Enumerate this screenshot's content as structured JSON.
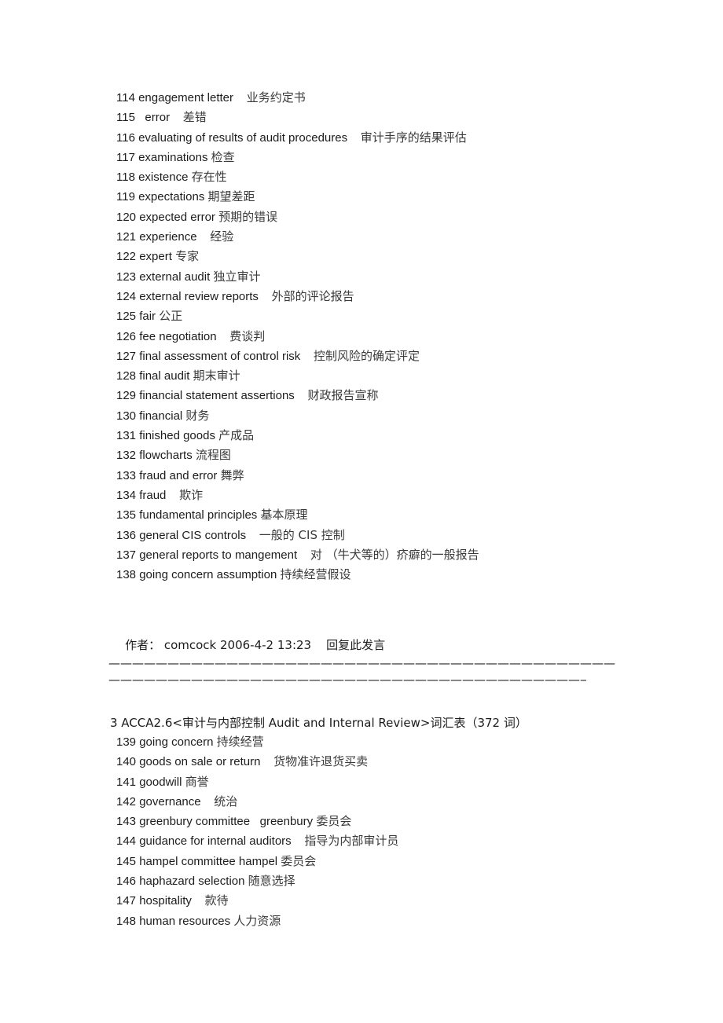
{
  "document": {
    "type": "forum-post-vocabulary-list",
    "background_color": "#ffffff",
    "text_color": "#1c1c1c",
    "secondary_text_color": "#3a3a3a"
  },
  "vocab_block_1": {
    "entries": [
      {
        "num": "114",
        "en": "engagement letter",
        "gap": "    ",
        "cn": "业务约定书"
      },
      {
        "num": "115",
        "en": "  error",
        "gap": "    ",
        "cn": "差错"
      },
      {
        "num": "116",
        "en": "evaluating of results of audit procedures",
        "gap": "    ",
        "cn": "审计手序的结果评估"
      },
      {
        "num": "117",
        "en": "examinations",
        "gap": " ",
        "cn": "检查"
      },
      {
        "num": "118",
        "en": "existence",
        "gap": " ",
        "cn": "存在性"
      },
      {
        "num": "119",
        "en": "expectations",
        "gap": " ",
        "cn": "期望差距"
      },
      {
        "num": "120",
        "en": "expected error",
        "gap": " ",
        "cn": "预期的错误"
      },
      {
        "num": "121",
        "en": "experience",
        "gap": "    ",
        "cn": "经验"
      },
      {
        "num": "122",
        "en": "expert",
        "gap": " ",
        "cn": "专家"
      },
      {
        "num": "123",
        "en": "external audit",
        "gap": " ",
        "cn": "独立审计"
      },
      {
        "num": "124",
        "en": "external review reports",
        "gap": "    ",
        "cn": "外部的评论报告"
      },
      {
        "num": "125",
        "en": "fair",
        "gap": " ",
        "cn": "公正"
      },
      {
        "num": "126",
        "en": "fee negotiation",
        "gap": "    ",
        "cn": "费谈判"
      },
      {
        "num": "127",
        "en": "final assessment of control risk",
        "gap": "    ",
        "cn": "控制风险的确定评定"
      },
      {
        "num": "128",
        "en": "final audit",
        "gap": " ",
        "cn": "期末审计"
      },
      {
        "num": "129",
        "en": "financial statement assertions",
        "gap": "    ",
        "cn": "财政报告宣称"
      },
      {
        "num": "130",
        "en": "financial",
        "gap": " ",
        "cn": "财务"
      },
      {
        "num": "131",
        "en": "finished goods",
        "gap": " ",
        "cn": "产成品"
      },
      {
        "num": "132",
        "en": "flowcharts",
        "gap": " ",
        "cn": "流程图"
      },
      {
        "num": "133",
        "en": "fraud and error",
        "gap": " ",
        "cn": "舞弊"
      },
      {
        "num": "134",
        "en": "fraud",
        "gap": "    ",
        "cn": "欺诈"
      },
      {
        "num": "135",
        "en": "fundamental principles",
        "gap": " ",
        "cn": "基本原理"
      },
      {
        "num": "136",
        "en": "general CIS controls",
        "gap": "    ",
        "cn": "一般的 CIS 控制"
      },
      {
        "num": "137",
        "en": "general reports to mangement",
        "gap": "    ",
        "cn": "对 （牛犬等的）疥癖的一般报告"
      },
      {
        "num": "138",
        "en": "going concern assumption",
        "gap": " ",
        "cn": "持续经营假设"
      }
    ]
  },
  "author_meta": {
    "label": "作者：",
    "username": "comcock",
    "timestamp": "2006-4-2 13:23",
    "reply_link": "回复此发言",
    "full_text": "作者： comcock 2006-4-2 13:23    回复此发言"
  },
  "separators": {
    "dash_char": "—",
    "line_1": "———————————————————————————————————————————",
    "line_2": "—————————————————————————————————————————"
  },
  "section_heading": {
    "index": "3",
    "course": "ACCA2.6",
    "title_cn": "审计与内部控制",
    "title_en": "Audit and Internal Review",
    "kind_cn": "词汇表",
    "word_count": "372 词",
    "full_text": "3 ACCA2.6<审计与内部控制 Audit and Internal Review>词汇表（372 词）"
  },
  "vocab_block_2": {
    "entries": [
      {
        "num": "139",
        "en": "going concern",
        "gap": " ",
        "cn": "持续经营"
      },
      {
        "num": "140",
        "en": "goods on sale or return",
        "gap": "    ",
        "cn": "货物准许退货买卖"
      },
      {
        "num": "141",
        "en": "goodwill",
        "gap": " ",
        "cn": "商誉"
      },
      {
        "num": "142",
        "en": "governance",
        "gap": "    ",
        "cn": "统治"
      },
      {
        "num": "143",
        "en": "greenbury committee   greenbury",
        "gap": " ",
        "cn": "委员会"
      },
      {
        "num": "144",
        "en": "guidance for internal auditors",
        "gap": "    ",
        "cn": "指导为内部审计员"
      },
      {
        "num": "145",
        "en": "hampel committee hampel",
        "gap": " ",
        "cn": "委员会"
      },
      {
        "num": "146",
        "en": "haphazard selection",
        "gap": " ",
        "cn": "随意选择"
      },
      {
        "num": "147",
        "en": "hospitality",
        "gap": "    ",
        "cn": "款待"
      },
      {
        "num": "148",
        "en": "human resources",
        "gap": " ",
        "cn": "人力资源"
      }
    ]
  }
}
